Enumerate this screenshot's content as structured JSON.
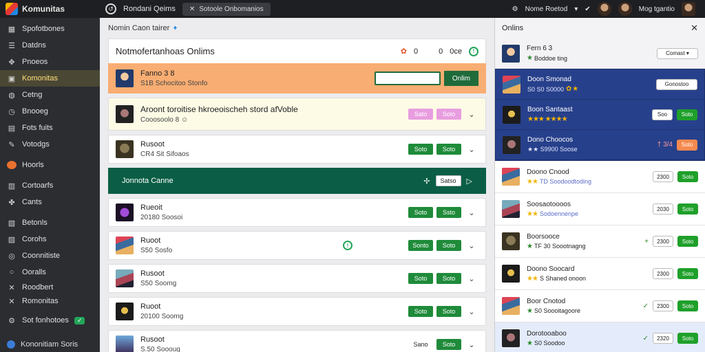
{
  "app": {
    "title": "Komunitas"
  },
  "topbar": {
    "left_label": "Rondani Qeims",
    "pill_label": "Sotoole Onbomanios",
    "right_label": "Nome Roetod",
    "user_label": "Mog tgantio"
  },
  "sidebar": {
    "items": [
      {
        "icon": "grid-icon",
        "label": "Spofotbones"
      },
      {
        "icon": "list-icon",
        "label": "Datdns"
      },
      {
        "icon": "people-icon",
        "label": "Pnoeos"
      },
      {
        "icon": "chat-icon",
        "label": "Komonitas",
        "active": true
      },
      {
        "icon": "globe-icon",
        "label": "Cetng"
      },
      {
        "icon": "clock-icon",
        "label": "Bnooeg"
      },
      {
        "icon": "book-icon",
        "label": "Fots fuits"
      },
      {
        "icon": "pen-icon",
        "label": "Votodgs"
      },
      {
        "icon": "fire-icon",
        "label": "Hoorls"
      },
      {
        "icon": "calendar-icon",
        "label": "Cortoarfs"
      },
      {
        "icon": "tag-icon",
        "label": "Cants"
      },
      {
        "icon": "box-icon",
        "label": "Betonls"
      },
      {
        "icon": "chart-icon",
        "label": "Corohs"
      },
      {
        "icon": "message-icon",
        "label": "Coonnitiste"
      },
      {
        "icon": "circle-icon",
        "label": "Ooralls"
      },
      {
        "icon": "cross-icon",
        "label": "Roodbert"
      },
      {
        "icon": "cross-icon",
        "label": "Romonitas"
      },
      {
        "icon": "gear-icon",
        "label": "Sot fonhotoes",
        "badge": "✓"
      }
    ],
    "footer": "Kononitiam Soris"
  },
  "main": {
    "breadcrumb": "Nomin Caon tairer",
    "section_title": "Notmofertanhoas Onlims",
    "section_count1": "0",
    "section_count2": "0",
    "section_count3": "0ce",
    "rows": [
      {
        "title": "Fanno 3 8",
        "sub": "S1B Schocitoo Stonfo",
        "input_btn": "Onlim"
      },
      {
        "title": "Aroont toroitise hkroeoischeh stord afVoble",
        "sub": "Cooosoolo 8 ☺",
        "btn1": "Sato",
        "btn2": "Soto"
      },
      {
        "title": "Rusoot",
        "sub": "CR4 Sit Sifoaos",
        "btn1": "Soto",
        "btn2": "Soto"
      },
      {
        "title": "Rueoit",
        "sub": "20180 Soosoi",
        "btn1": "Soto",
        "btn2": "Ssto"
      },
      {
        "title": "Ruoot",
        "sub": "S50 Sosfo",
        "btn1": "Sonto",
        "btn2": "Soto"
      },
      {
        "title": "Rusoot",
        "sub": "S50 Soomg",
        "btn1": "Soto",
        "btn2": "Soto"
      },
      {
        "title": "Ruoot",
        "sub": "20100 Soomg",
        "btn1": "Soto",
        "btn2": "Soto"
      },
      {
        "title": "Rusoot",
        "sub": "S.50 Soooug",
        "btn1": "Sano",
        "btn2": "Soto"
      }
    ],
    "band": {
      "title": "Jonnota Canne",
      "btn": "Satso"
    }
  },
  "panel": {
    "title": "Onlins",
    "top": {
      "title": "Fern 6 3",
      "sub": "Boddoe ting",
      "select": "Comast"
    },
    "items": [
      {
        "title": "Doon Smonad",
        "sub": "S0 S0 S0000",
        "btn": "Gonostoo",
        "dark": true
      },
      {
        "title": "Boon Santaast",
        "sub": "★★★ ★★★★",
        "btn1": "Soo",
        "btn2": "Soto",
        "dark": true
      },
      {
        "title": "Dono Choocos",
        "sub": "★★ S9900 Soose",
        "mark": "† 3/4",
        "btn": "Soto",
        "dark": true
      },
      {
        "title": "Doono Cnood",
        "sub": "TD Soodoodtoding",
        "btn1": "2300",
        "btn2": "Soto"
      },
      {
        "title": "Soosaotoooos",
        "sub": "Sodoennenpe",
        "btn1": "2030",
        "btn2": "Soto"
      },
      {
        "title": "Boorsooce",
        "sub": "TF 30 Soootnagng",
        "btn1": "2300",
        "btn2": "Soto"
      },
      {
        "title": "Doono Soocard",
        "sub": "S Shaned onoon",
        "btn1": "2300",
        "btn2": "Soto"
      },
      {
        "title": "Boor Cnotod",
        "sub": "S0 Soooitagoore",
        "btn1": "2300",
        "btn2": "Soto"
      },
      {
        "title": "Dorotooaboo",
        "sub": "S0 Soodoo",
        "btn1": "2320",
        "btn2": "Soto"
      }
    ]
  }
}
